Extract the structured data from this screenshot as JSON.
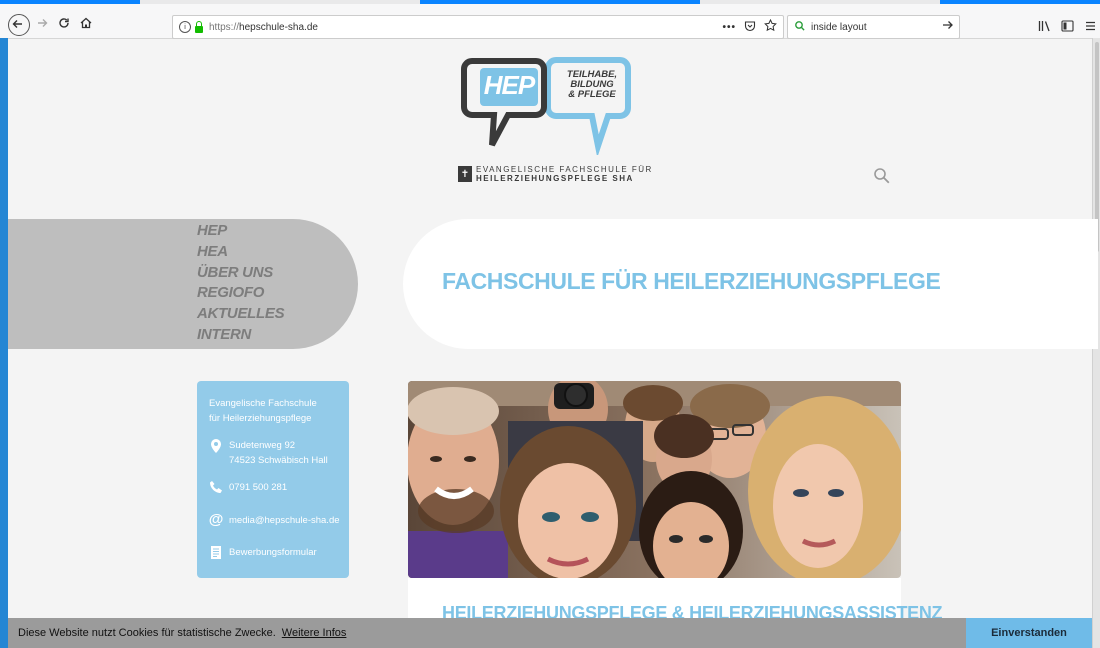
{
  "browser": {
    "url_info_icon": "info-icon",
    "url": "https://hepschule-sha.de",
    "url_scheme": "https://",
    "url_host": "hepschule-sha.de",
    "page_actions": "•••",
    "search_query": "inside layout"
  },
  "logo": {
    "left_bubble": "HEP",
    "right_bubble_lines": [
      "TEILHABE,",
      "BILDUNG",
      "& PFLEGE"
    ],
    "subtitle_line1": "EVANGELISCHE FACHSCHULE FÜR",
    "subtitle_line2": "HEILERZIEHUNGSPFLEGE SHA"
  },
  "nav": {
    "items": [
      {
        "label": "HEP"
      },
      {
        "label": "HEA"
      },
      {
        "label": "ÜBER UNS"
      },
      {
        "label": "REGIOFO"
      },
      {
        "label": "AKTUELLES"
      },
      {
        "label": "INTERN"
      }
    ]
  },
  "banner": {
    "title": "FACHSCHULE FÜR HEILERZIEHUNGSPFLEGE"
  },
  "contact": {
    "title_line1": "Evangelische Fachschule",
    "title_line2": "für Heilerziehungspflege",
    "street": "Sudetenweg 92",
    "city": "74523 Schwäbisch Hall",
    "phone": "0791 500 281",
    "email": "media@hepschule-sha.de",
    "form": "Bewerbungsformular"
  },
  "content": {
    "heading": "HEILERZIEHUNGSPFLEGE & HEILERZIEHUNGSASSISTENZ"
  },
  "cookie": {
    "text": "Diese Website nutzt Cookies für statistische Zwecke.",
    "link": "Weitere Infos",
    "button": "Einverstanden"
  },
  "colors": {
    "accent_blue": "#7ec3e6",
    "contact_bg": "#93cbe9",
    "nav_bg": "#bebebe",
    "cookie_bg": "#9b9b9b",
    "cookie_button": "#6fbbe8"
  }
}
